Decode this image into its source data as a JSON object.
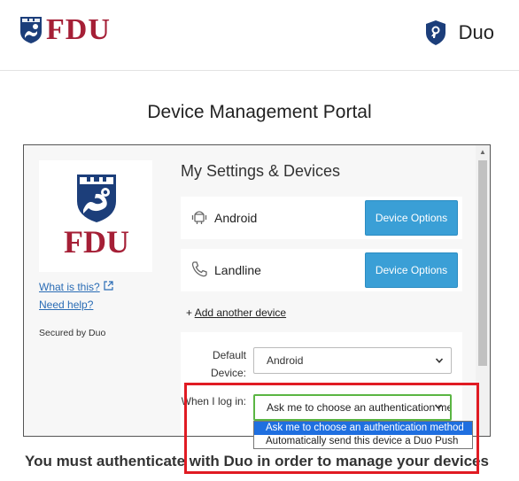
{
  "header": {
    "fdu_logo_text": "FDU",
    "duo_text": "Duo"
  },
  "portal_title": "Device Management Portal",
  "sidebar": {
    "logo_text": "FDU",
    "what_is_this": "What is this?",
    "need_help": "Need help?",
    "secured_by": "Secured by Duo"
  },
  "main": {
    "title": "My Settings & Devices",
    "devices": [
      {
        "name": "Android",
        "icon": "android-icon",
        "button": "Device Options"
      },
      {
        "name": "Landline",
        "icon": "phone-icon",
        "button": "Device Options"
      }
    ],
    "add_prefix": "+",
    "add_link": "Add another device",
    "default_device_label": "Default Device:",
    "default_device_value": "Android",
    "when_login_label": "When I log in:",
    "when_login_value": "Ask me to choose an authentication method"
  },
  "dropdown": {
    "options": [
      "Ask me to choose an authentication method",
      "Automatically send this device a Duo Push"
    ],
    "selected_index": 0
  },
  "bottom_message": "You must authenticate with Duo in order to manage your devices",
  "colors": {
    "fdu_red": "#a51f36",
    "fdu_navy": "#1c3e7a",
    "button_blue": "#3a9fd6",
    "highlight_red": "#e01b23",
    "focus_green": "#5ab543"
  }
}
